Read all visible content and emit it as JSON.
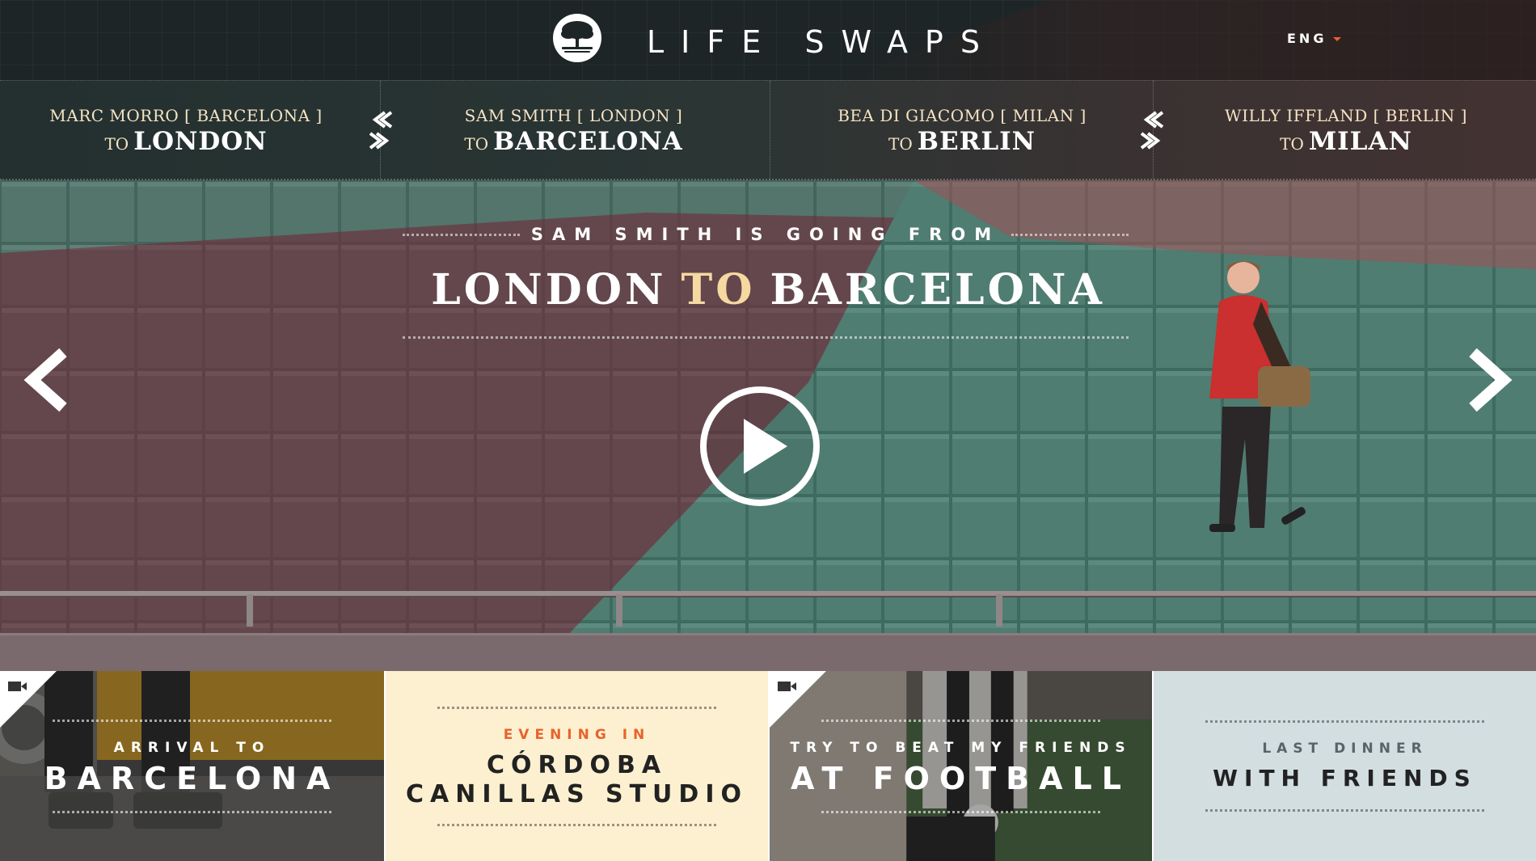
{
  "header": {
    "brand": "LIFE SWAPS",
    "logo_icon": "tree-logo-icon",
    "language": "ENG",
    "accent_color": "#e8632b"
  },
  "swaps": [
    {
      "who": "MARC MORRO [ BARCELONA ]",
      "to": "TO",
      "city": "LONDON"
    },
    {
      "who": "SAM SMITH [ LONDON ]",
      "to": "TO",
      "city": "BARCELONA"
    },
    {
      "who": "BEA DI GIACOMO [ MILAN ]",
      "to": "TO",
      "city": "BERLIN"
    },
    {
      "who": "WILLY IFFLAND [ BERLIN ]",
      "to": "TO",
      "city": "MILAN"
    }
  ],
  "hero": {
    "subtitle": "SAM SMITH IS GOING FROM",
    "from": "LONDON",
    "to_word": "TO",
    "destination": "BARCELONA",
    "play_icon": "play-icon",
    "prev_icon": "chevron-left-icon",
    "next_icon": "chevron-right-icon"
  },
  "tiles": [
    {
      "small": "ARRIVAL TO",
      "big": "BARCELONA",
      "video": true
    },
    {
      "small": "EVENING IN",
      "big_line1": "CÓRDOBA",
      "big_line2": "CANILLAS STUDIO",
      "video": false
    },
    {
      "small": "TRY TO BEAT MY FRIENDS",
      "big": "AT FOOTBALL",
      "video": true
    },
    {
      "small": "LAST DINNER",
      "big": "WITH FRIENDS",
      "video": false
    }
  ]
}
